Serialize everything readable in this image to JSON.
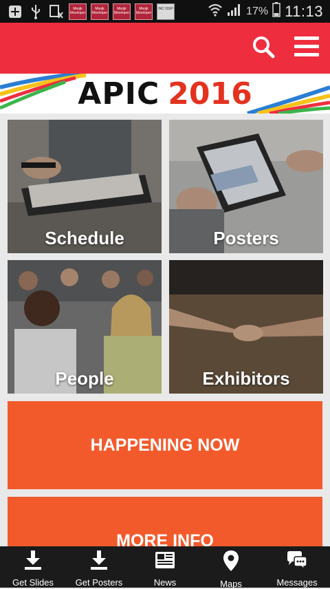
{
  "status_bar": {
    "battery": "17%",
    "time": "11:13",
    "notification_thumbs": [
      "Moojk Moorloper",
      "Moojk Moorloper",
      "Moojk Moorloper",
      "Moojk Moorloper",
      "INC ISSP"
    ]
  },
  "header": {
    "brand_color": "#ee2e3f"
  },
  "banner": {
    "logo_left": "APIC",
    "logo_right": "2016"
  },
  "tiles": [
    {
      "label": "Schedule"
    },
    {
      "label": "Posters"
    },
    {
      "label": "People"
    },
    {
      "label": "Exhibitors"
    }
  ],
  "actions": {
    "happening_now": "HAPPENING NOW",
    "more_info": "MORE INFO",
    "accent": "#f25a2c"
  },
  "bottom_nav": [
    {
      "label": "Get Slides",
      "icon": "download-icon"
    },
    {
      "label": "Get Posters",
      "icon": "download-icon"
    },
    {
      "label": "News",
      "icon": "newspaper-icon"
    },
    {
      "label": "Maps",
      "icon": "map-pin-icon"
    },
    {
      "label": "Messages",
      "icon": "chat-bubbles-icon"
    }
  ]
}
